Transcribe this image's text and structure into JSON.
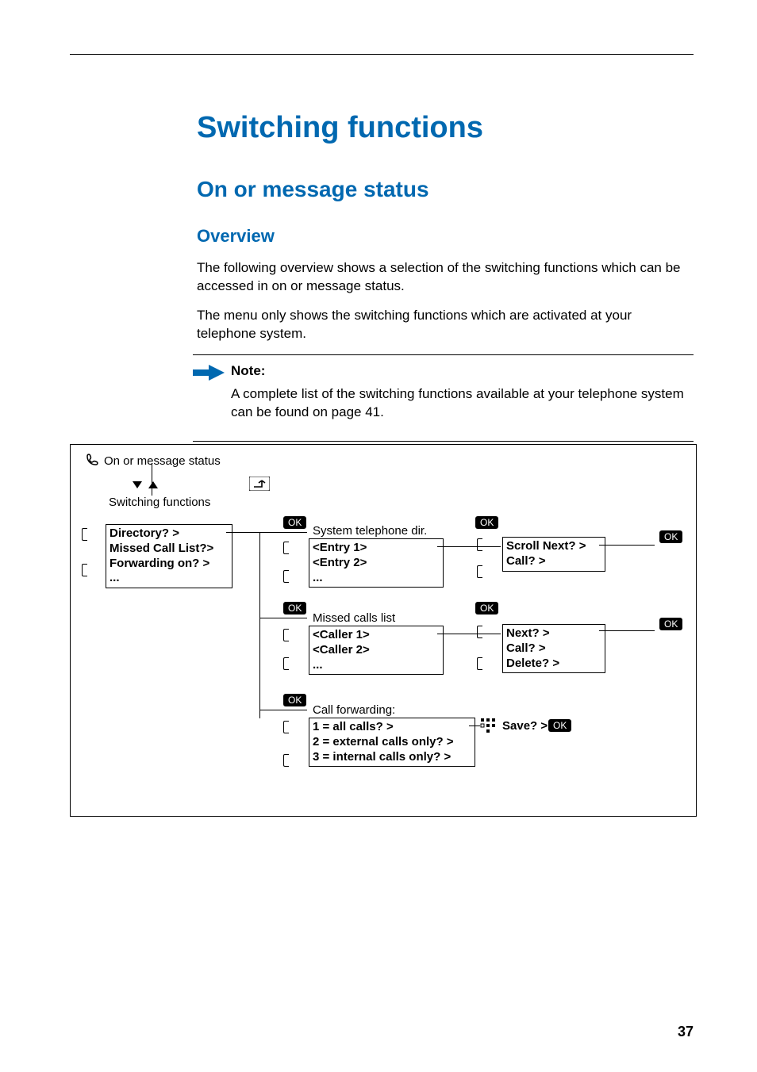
{
  "page_number": "37",
  "h1": "Switching functions",
  "h2": "On or message status",
  "h3": "Overview",
  "para1": "The following overview shows a selection of the switching functions which can be accessed in on or message status.",
  "para2": "The menu only shows the switching functions which are activated at your telephone system.",
  "note": {
    "heading": "Note:",
    "text": "A complete list of the switching functions available at your telephone system can be found on page 41."
  },
  "diagram": {
    "root_title": "On or message status",
    "root_sub": "Switching functions",
    "ok": "OK",
    "menu1": {
      "items": [
        "Directory? >",
        "Missed Call List?>",
        "Forwarding on? >",
        "..."
      ]
    },
    "branch_dir": {
      "title": "System telephone dir.",
      "items": [
        "<Entry 1>",
        "<Entry 2>",
        "..."
      ],
      "next_items": [
        "Scroll Next? >",
        "Call? >"
      ]
    },
    "branch_missed": {
      "title": "Missed calls list",
      "items": [
        "<Caller 1>",
        "<Caller 2>",
        "..."
      ],
      "next_items": [
        "Next? >",
        "Call? >",
        "Delete? >"
      ]
    },
    "branch_fwd": {
      "title": "Call forwarding:",
      "items": [
        "1 = all calls? >",
        "2 = external calls only? >",
        "3 = internal calls only? >"
      ],
      "save": "Save? >"
    }
  }
}
